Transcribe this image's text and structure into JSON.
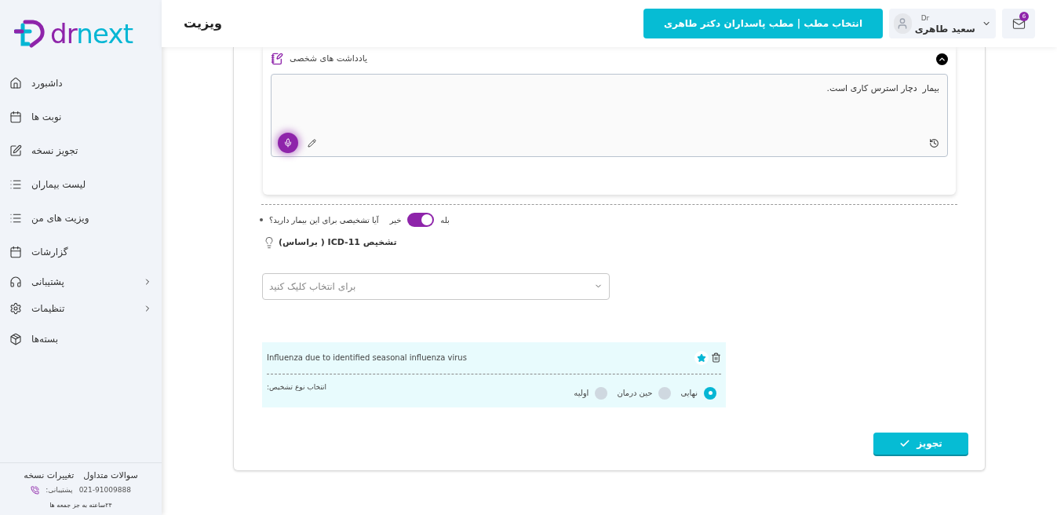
{
  "sidebar": {
    "logo": {
      "part_1": "dr",
      "part_2": "next"
    },
    "items": [
      {
        "label": "داشبورد",
        "selected": false
      },
      {
        "label": "نوبت ها",
        "selected": false
      },
      {
        "label": "تجویز نسخه",
        "selected": false
      },
      {
        "label": "لیست بیماران",
        "selected": false
      },
      {
        "label": "ویزیت های من",
        "selected": false
      },
      {
        "label": "گزارشات",
        "selected": false
      },
      {
        "label": "پشتیبانی",
        "selected": false,
        "expanded": false
      },
      {
        "label": "تنظیمات",
        "selected": false,
        "expanded": false
      },
      {
        "label": "بسته‌ها",
        "selected": false
      }
    ],
    "footer": {
      "links": [
        "سوالات متداول",
        "تغییرات نسخه"
      ],
      "phone": "021-91009888",
      "phone_label": ":پشتیبانی",
      "hours": "۲۴ساعته به جز جمعه ها"
    }
  },
  "header": {
    "title": "ویزیت",
    "clinic_button": "انتخاب مطب | مطب پاسداران دکتر طاهری",
    "user": {
      "prefix": "Dr",
      "name": "سعید طاهری"
    },
    "mail_badge": "6"
  },
  "notes": {
    "title": "یادداشت های شخصی",
    "expanded": true,
    "value": "بیمار  دچار استرس کاری است."
  },
  "diagnosis": {
    "question": "آیا تشخیصی برای این بیمار دارید؟",
    "no_label": "خیر",
    "yes_label": "بله",
    "on": true,
    "icd_heading": "تشخیص ICD-11 ( براساس)",
    "select_placeholder": "برای انتخاب کلیک کنید",
    "items": [
      {
        "title": "Influenza due to identified seasonal influenza virus",
        "favorite": true,
        "type_label": "انتخاب نوع تشخیص:",
        "types": [
          {
            "label": "نهایی",
            "selected": true
          },
          {
            "label": "حین درمان",
            "selected": false
          },
          {
            "label": "اولیه",
            "selected": false
          }
        ]
      }
    ]
  },
  "submit_button": "تجویز"
}
